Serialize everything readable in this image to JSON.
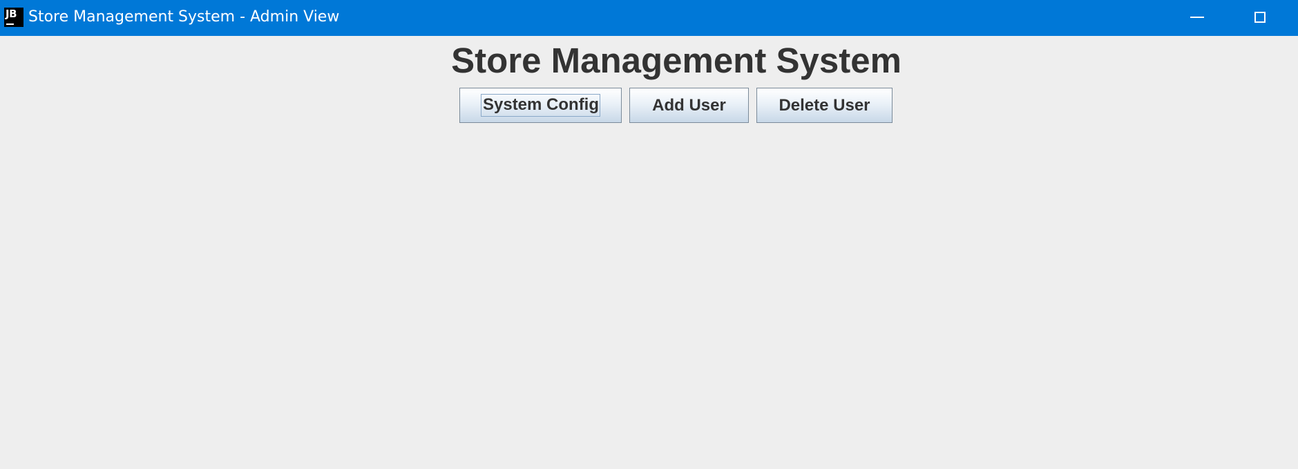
{
  "window": {
    "title": "Store Management System - Admin View",
    "icon_text": "JB",
    "icon": "jetbrains-app-icon",
    "title_bar_color": "#0078d7"
  },
  "main": {
    "heading": "Store Management System",
    "buttons": {
      "system_config": "System Config",
      "add_user": "Add User",
      "delete_user": "Delete User"
    },
    "focused_button": "System Config"
  }
}
